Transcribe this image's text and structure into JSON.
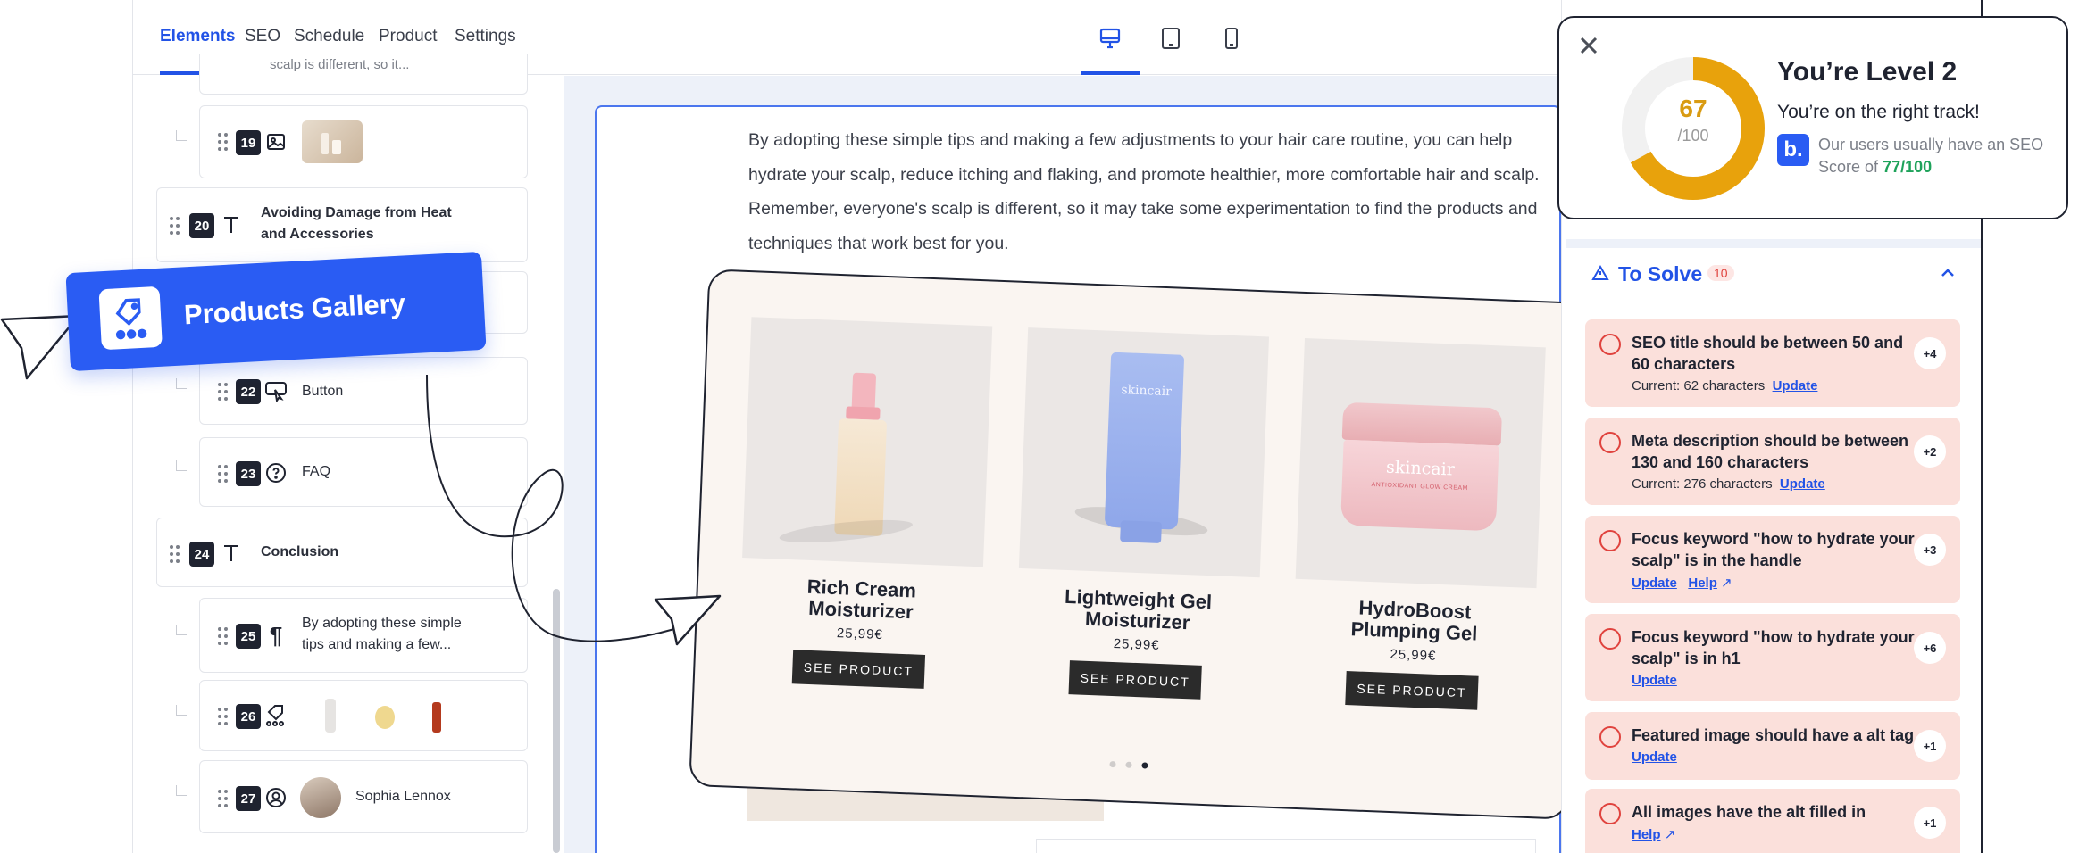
{
  "sidebar": {
    "tabs": [
      "Elements",
      "SEO",
      "Schedule",
      "Product",
      "Settings"
    ],
    "active_tab": "Elements",
    "items": [
      {
        "num": "19",
        "type": "image"
      },
      {
        "num": "20",
        "type": "heading",
        "label_line1": "Avoiding Damage from Heat",
        "label_line2": "and Accessories"
      },
      {
        "num": "22",
        "type": "button",
        "label": "Button"
      },
      {
        "num": "23",
        "type": "faq",
        "label": "FAQ"
      },
      {
        "num": "24",
        "type": "heading",
        "label": "Conclusion"
      },
      {
        "num": "25",
        "type": "paragraph",
        "label_line1": "By adopting these simple",
        "label_line2": "tips and making a few..."
      },
      {
        "num": "26",
        "type": "products"
      },
      {
        "num": "27",
        "type": "author",
        "label": "Sophia Lennox"
      }
    ],
    "partial_text": "scalp is different, so it..."
  },
  "tooltip": {
    "label": "Products Gallery"
  },
  "device_icons": [
    "desktop-icon",
    "tablet-icon",
    "mobile-icon"
  ],
  "content": {
    "paragraph": "By adopting these simple tips and making a few adjustments to your hair care routine, you can help hydrate your scalp, reduce itching and flaking, and promote healthier, more comfortable hair and scalp. Remember, everyone's scalp is different, so it may take some experimentation to find the products and techniques that work best for you."
  },
  "gallery": {
    "products": [
      {
        "name_line1": "Rich Cream",
        "name_line2": "Moisturizer",
        "price": "25,99€",
        "button": "SEE PRODUCT"
      },
      {
        "name_line1": "Lightweight Gel",
        "name_line2": "Moisturizer",
        "price": "25,99€",
        "button": "SEE PRODUCT",
        "brand": "skincair"
      },
      {
        "name_line1": "HydroBoost",
        "name_line2": "Plumping Gel",
        "price": "25,99€",
        "button": "SEE PRODUCT",
        "brand": "skincair",
        "jar_text": "ANTIOXIDANT GLOW CREAM"
      }
    ],
    "active_dot": 3,
    "dot_count": 3
  },
  "level_card": {
    "score": "67",
    "score_max": "/100",
    "score_fraction": 0.67,
    "title": "You’re Level 2",
    "subtitle": "You’re on the right track!",
    "logo": "b.",
    "avg_text": "Our users usually have an SEO Score of",
    "avg_score": "77/100"
  },
  "to_solve": {
    "title": "To Solve",
    "count": "10",
    "issues": [
      {
        "title": "SEO title should be between 50 and 60 characters",
        "current": "Current: 62 characters",
        "links": [
          "Update"
        ],
        "badge": "+4"
      },
      {
        "title": "Meta description should be between 130 and 160 characters",
        "current": "Current: 276 characters",
        "links": [
          "Update"
        ],
        "badge": "+2"
      },
      {
        "title": "Focus keyword \"how to hydrate your scalp\" is in the handle",
        "current": "",
        "links": [
          "Update",
          "Help"
        ],
        "badge": "+3"
      },
      {
        "title": "Focus keyword \"how to hydrate your scalp\" is in h1",
        "current": "",
        "links": [
          "Update"
        ],
        "badge": "+6"
      },
      {
        "title": "Featured image should have a alt tag",
        "current": "",
        "links": [
          "Update"
        ],
        "badge": "+1"
      },
      {
        "title": "All images have the alt filled in",
        "current": "",
        "links": [
          "Help"
        ],
        "badge": "+1"
      }
    ]
  },
  "colors": {
    "accent": "#2253e6",
    "issue_bg": "#fbe0db",
    "issue_red": "#e0433e",
    "score_gold": "#e8a20c",
    "good_green": "#1ea25a"
  }
}
